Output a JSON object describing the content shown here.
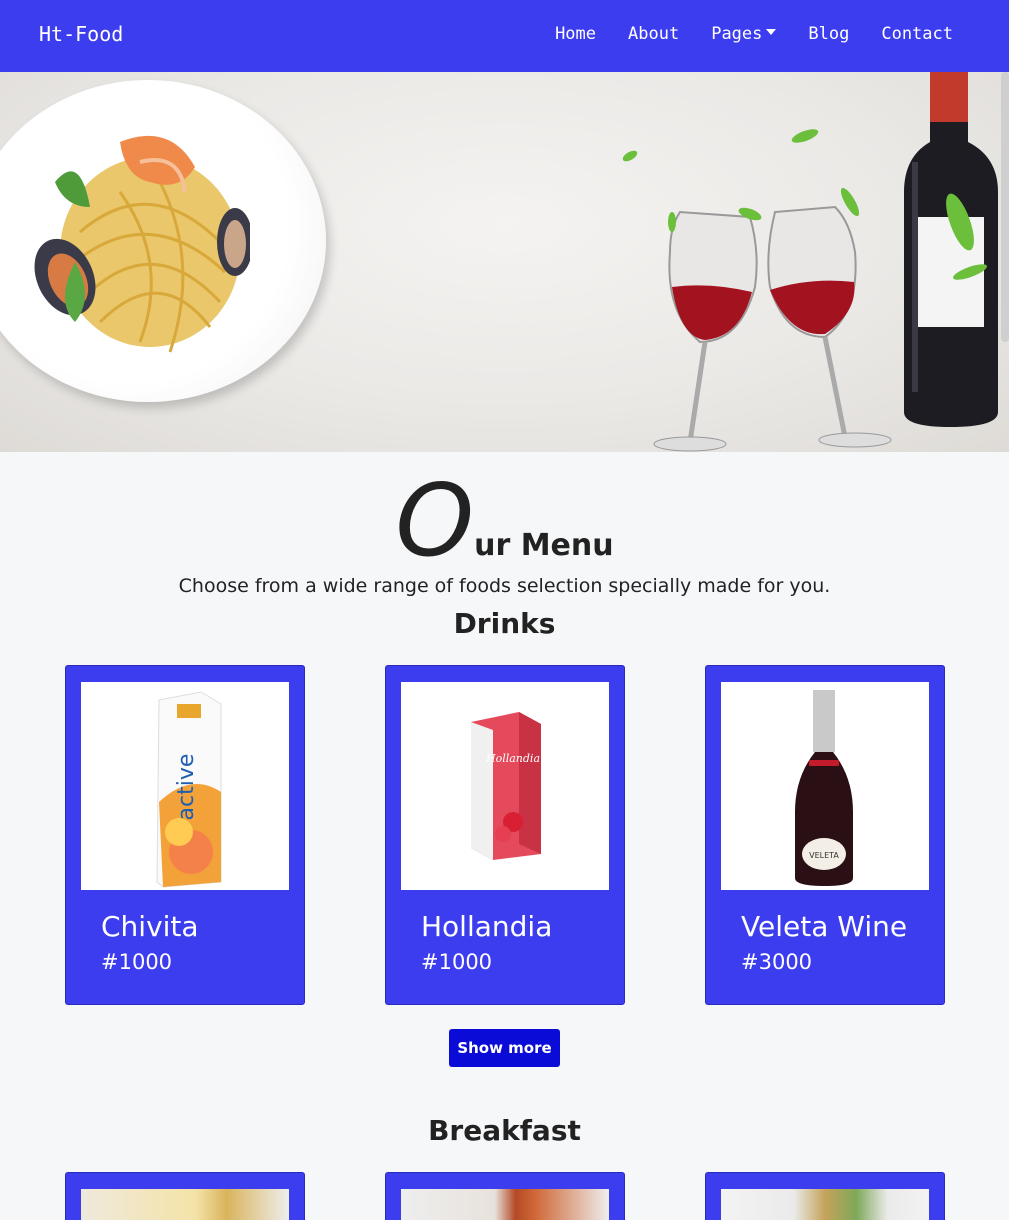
{
  "navbar": {
    "brand": "Ht-Food",
    "links": [
      {
        "label": "Home"
      },
      {
        "label": "About"
      },
      {
        "label": "Pages"
      },
      {
        "label": "Blog"
      },
      {
        "label": "Contact"
      }
    ]
  },
  "menu": {
    "title_initial": "O",
    "title_rest": "ur Menu",
    "subtitle": "Choose from a wide range of foods selection specially made for you."
  },
  "drinks": {
    "heading": "Drinks",
    "items": [
      {
        "name": "Chivita",
        "price": "#1000"
      },
      {
        "name": "Hollandia",
        "price": "#1000"
      },
      {
        "name": "Veleta Wine",
        "price": "#3000"
      }
    ],
    "show_more": "Show more"
  },
  "breakfast": {
    "heading": "Breakfast"
  },
  "colors": {
    "primary": "#3d3df0",
    "button": "#0b0bd8",
    "background": "#f6f7f9"
  }
}
